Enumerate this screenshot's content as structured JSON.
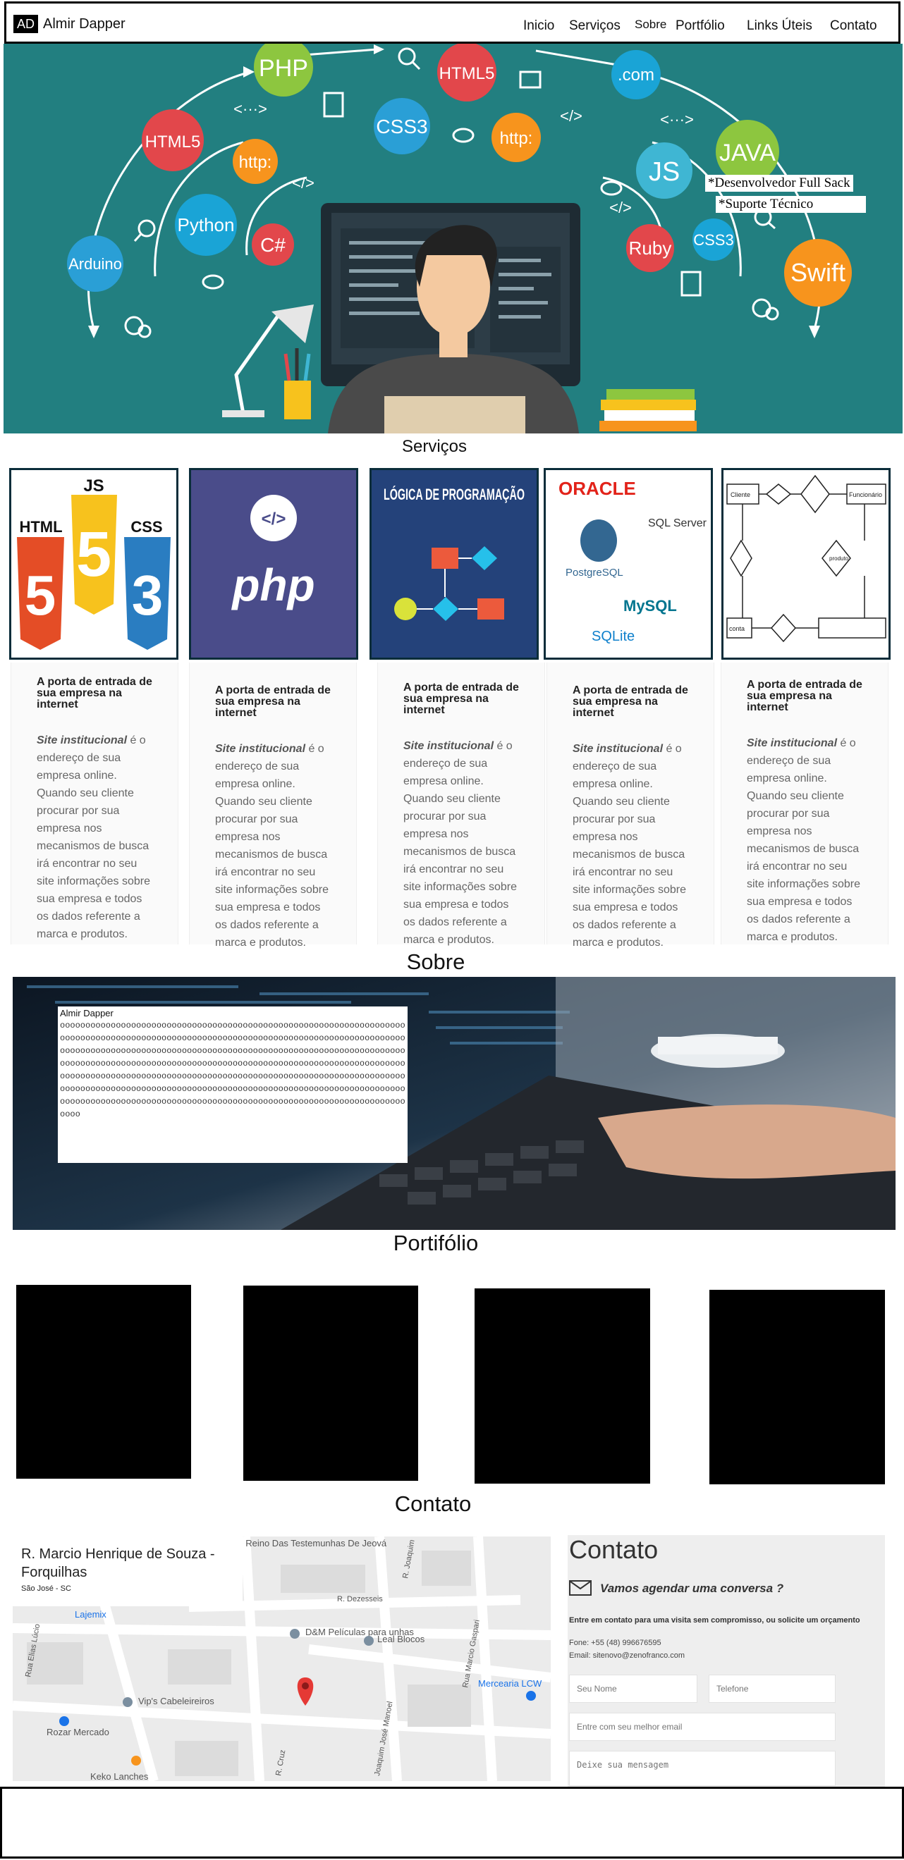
{
  "nav": {
    "badge": "AD",
    "brand": "Almir Dapper",
    "items": [
      "Inicio",
      "Serviços",
      "Sobre",
      "Portfólio",
      "Links Úteis",
      "Contato"
    ]
  },
  "hero": {
    "tags": [
      "*Desenvolvedor Full Sack",
      "*Suporte Técnico"
    ],
    "bubbles": [
      "PHP",
      "HTML5",
      "HTML5",
      "CSS3",
      "http:",
      "http:",
      ".com",
      "JS",
      "JAVA",
      "Python",
      "C#",
      "Arduino",
      "Ruby",
      "CSS3",
      "Swift"
    ],
    "symbols": [
      "<···>",
      "</>",
      "</>",
      "<···>",
      "</>"
    ]
  },
  "servicos": {
    "title": "Serviços",
    "images": [
      {
        "html": "HTML",
        "js": "JS",
        "css": "CSS"
      },
      {
        "label": "php"
      },
      {
        "title": "LÓGICA DE PROGRAMAÇÃO"
      },
      {
        "oracle": "ORACLE",
        "sqlserver": "SQL Server",
        "postgres": "PostgreSQL",
        "mysql": "MySQL",
        "sqlite": "SQLite"
      },
      {
        "n1": "Cliente",
        "n2": "Funcionário",
        "n3": "produto",
        "n4": "conta"
      }
    ],
    "cards": [
      {
        "heading": "A porta de entrada de sua empresa na internet",
        "strong": "Site institucional",
        "text": " é o endereço de sua empresa online. Quando seu cliente procurar por sua empresa nos mecanismos de busca irá encontrar no seu site informações sobre sua empresa e todos os dados referente a marca e produtos."
      },
      {
        "heading": "A porta de entrada de sua empresa na internet",
        "strong": "Site institucional",
        "text": " é o endereço de sua empresa online. Quando seu cliente procurar por sua empresa nos mecanismos de busca irá encontrar no seu site informações sobre sua empresa e todos os dados referente a marca e produtos."
      },
      {
        "heading": "A porta de entrada de sua empresa na internet",
        "strong": "Site institucional",
        "text": " é o endereço de sua empresa online. Quando seu cliente procurar por sua empresa nos mecanismos de busca irá encontrar no seu site informações sobre sua empresa e todos os dados referente a marca e produtos."
      },
      {
        "heading": "A porta de entrada de sua empresa na internet",
        "strong": "Site institucional",
        "text": " é o endereço de sua empresa online. Quando seu cliente procurar por sua empresa nos mecanismos de busca irá encontrar no seu site informações sobre sua empresa e todos os dados referente a marca e produtos."
      },
      {
        "heading": "A porta de entrada de sua empresa na internet",
        "strong": "Site institucional",
        "text": " é o endereço de sua empresa online. Quando seu cliente procurar por sua empresa nos mecanismos de busca irá encontrar no seu site informações sobre sua empresa e todos os dados referente a marca e produtos."
      }
    ]
  },
  "sobre": {
    "title": "Sobre",
    "name": "Almir Dapper",
    "text": "oooooooooooooooooooooooooooooooooooooooooooooooooooooooooooooooooooooooooooooooooooooooooooooooooooooooooooooooooooooooooooooooooooooooooooooooooooooooooooooooooooooooooooooooooooooooooooooooooooooooooooooooooooooooooooooooooooooooooooooooooooooooooooooooooooooooooooooooooooooooooooooooooooooooooooooooooooooooooooooooooooooooooooooooooooooooooooooooooooooooooooooooooooooooooooooooooooooooooooooooooooooooooooooooooooooooooooooooooooooooooooooooooooooooooooooooooooooooooooooooo"
  },
  "portfolio": {
    "title": "Portifólio"
  },
  "contato": {
    "title": "Contato",
    "map": {
      "address": "R. Marcio Henrique de Souza - Forquilhas",
      "city": "São José - SC",
      "places": [
        "D&M Películas para unhas",
        "Leal Blocos",
        "Vip's Cabeleireiros",
        "Rozar Mercado",
        "Keko Lanches",
        "Lajemix",
        "Mercearia LCW",
        "Do Reino Das Testemunhas De Jeová"
      ],
      "streets": [
        "R. Dezesseis",
        "R. Joaquim",
        "Rua Marcio Gaspari",
        "Rua Elias Lúcio",
        "Joaquim José Manoel",
        "R. Cruz"
      ]
    },
    "form": {
      "title": "Contato",
      "subtitle": "Vamos agendar uma conversa ?",
      "intro": "Entre em contato para uma visita sem compromisso, ou solicite um orçamento",
      "phone": "Fone: +55 (48) 996676595",
      "email": "Email: sitenovo@zenofranco.com",
      "placeholders": {
        "name": "Seu Nome",
        "phone": "Telefone",
        "email": "Entre com seu melhor email",
        "message": "Deixe sua mensagem"
      }
    }
  },
  "colors": {
    "hero_bg": "#227f80",
    "card_bg": "#fafafa",
    "form_bg": "#eeeeee"
  }
}
